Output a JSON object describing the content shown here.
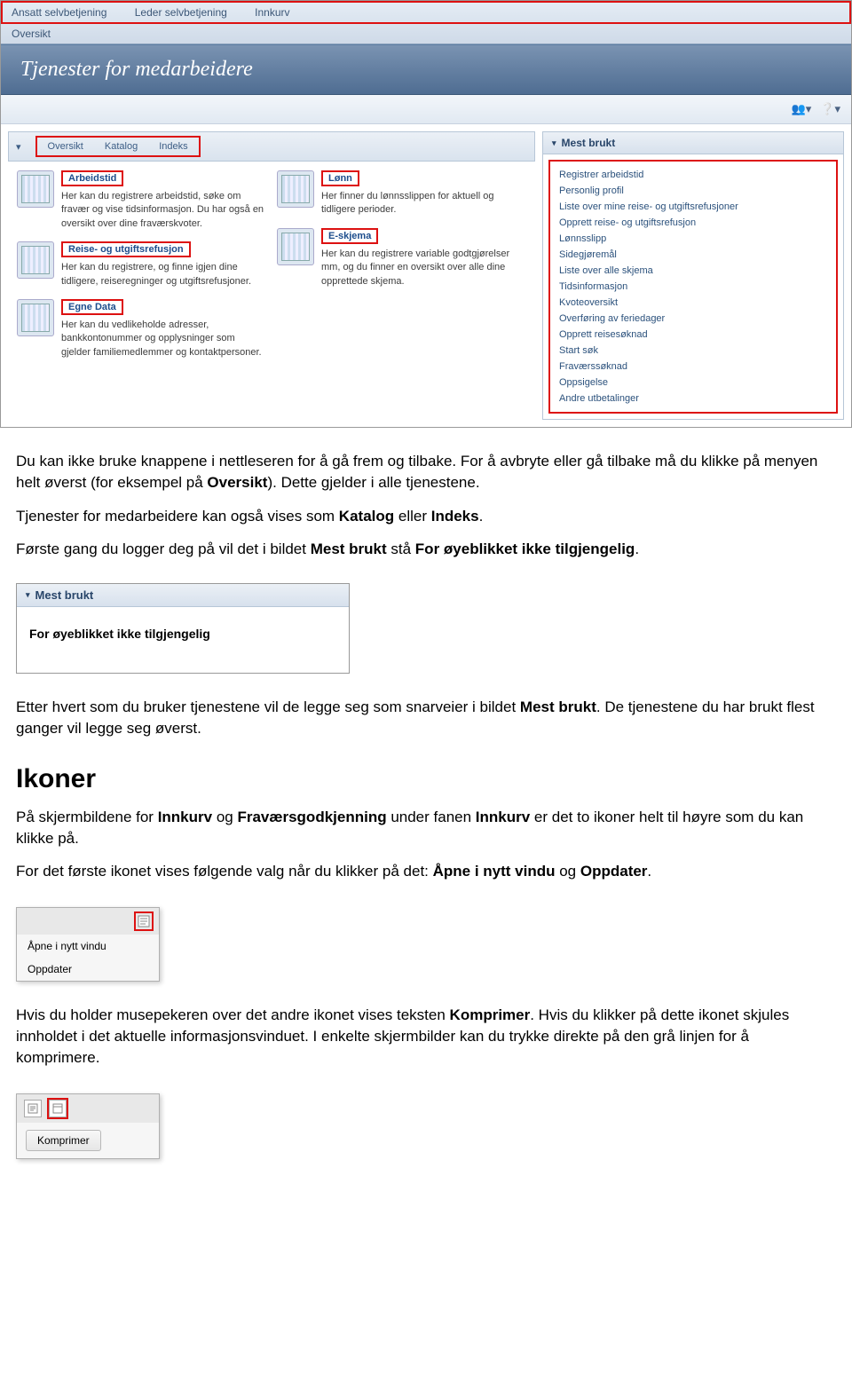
{
  "topnav": {
    "tabs": [
      "Ansatt selvbetjening",
      "Leder selvbetjening",
      "Innkurv"
    ],
    "subtab": "Oversikt"
  },
  "hero": {
    "title": "Tjenester for medarbeidere"
  },
  "tabbar": {
    "items": [
      "Oversikt",
      "Katalog",
      "Indeks"
    ]
  },
  "cards_left": [
    {
      "title": "Arbeidstid",
      "desc": "Her kan du registrere arbeidstid, søke om fravær og vise tidsinformasjon.\nDu har også en oversikt over dine fraværskvoter."
    },
    {
      "title": "Reise- og utgiftsrefusjon",
      "desc": "Her kan du registrere, og finne igjen dine tidligere, reiseregninger og utgiftsrefusjoner."
    },
    {
      "title": "Egne Data",
      "desc": "Her kan du vedlikeholde adresser, bankkontonummer og opplysninger som gjelder familiemedlemmer og kontaktpersoner."
    }
  ],
  "cards_right": [
    {
      "title": "Lønn",
      "desc": "Her finner du lønnsslippen for aktuell og tidligere perioder."
    },
    {
      "title": "E-skjema",
      "desc": "Her kan du registrere variable godtgjørelser mm, og du finner en oversikt over alle dine opprettede skjema."
    }
  ],
  "mest_brukt": {
    "title": "Mest brukt",
    "items": [
      "Registrer arbeidstid",
      "Personlig profil",
      "Liste over mine reise- og utgiftsrefusjoner",
      "Opprett reise- og utgiftsrefusjon",
      "Lønnsslipp",
      "Sidegjøremål",
      "Liste over alle skjema",
      "Tidsinformasjon",
      "Kvoteoversikt",
      "Overføring av feriedager",
      "Opprett reisesøknad",
      "Start søk",
      "Fraværssøknad",
      "Oppsigelse",
      "Andre utbetalinger"
    ]
  },
  "doc": {
    "p1_a": "Du kan ikke bruke knappene i nettleseren for å gå frem og tilbake. For å avbryte eller gå tilbake må du klikke på menyen helt øverst (for eksempel på ",
    "p1_bold1": "Oversikt",
    "p1_b": "). Dette gjelder i alle tjenestene.",
    "p2_a": "Tjenester for medarbeidere kan også vises som ",
    "p2_bold1": "Katalog",
    "p2_mid": " eller ",
    "p2_bold2": "Indeks",
    "p2_b": ".",
    "p3_a": "Første gang du logger deg på vil det i bildet ",
    "p3_bold1": "Mest brukt",
    "p3_mid": " stå ",
    "p3_bold2": "For øyeblikket ikke tilgjengelig",
    "p3_b": ".",
    "p4_a": "Etter hvert som du bruker tjenestene vil de legge seg som snarveier i bildet ",
    "p4_bold1": "Mest brukt",
    "p4_b": ". De tjenestene du har brukt flest ganger vil legge seg øverst.",
    "h1": "Ikoner",
    "p5_a": "På skjermbildene for ",
    "p5_bold1": "Innkurv",
    "p5_mid1": " og ",
    "p5_bold2": "Fraværsgodkjenning",
    "p5_mid2": " under fanen ",
    "p5_bold3": "Innkurv",
    "p5_b": " er det to ikoner helt til høyre som du kan klikke på.",
    "p6_a": "For det første ikonet vises følgende valg når du klikker på det: ",
    "p6_bold1": "Åpne i nytt vindu",
    "p6_mid": " og ",
    "p6_bold2": "Oppdater",
    "p6_b": ".",
    "p7_a": "Hvis du holder musepekeren over det andre ikonet vises teksten ",
    "p7_bold1": "Komprimer",
    "p7_b": ". Hvis du klikker på dette ikonet skjules innholdet i det aktuelle informasjonsvinduet. I enkelte skjermbilder kan du trykke direkte på den grå linjen for å komprimere."
  },
  "small_shot1": {
    "title": "Mest brukt",
    "body": "For øyeblikket ikke tilgjengelig"
  },
  "popup1": {
    "items": [
      "Åpne i nytt vindu",
      "Oppdater"
    ]
  },
  "popup2": {
    "btn": "Komprimer"
  }
}
